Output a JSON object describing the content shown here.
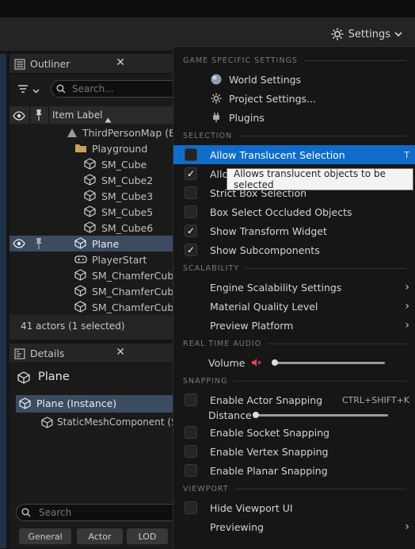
{
  "toolbar": {
    "settings_label": "Settings"
  },
  "outliner": {
    "title": "Outliner",
    "search_placeholder": "Search...",
    "column_item_label": "Item Label",
    "rows": [
      {
        "label": "ThirdPersonMap (Ed",
        "icon": "map-icon"
      },
      {
        "label": "Playground",
        "icon": "folder-icon"
      },
      {
        "label": "SM_Cube",
        "icon": "static-mesh-icon"
      },
      {
        "label": "SM_Cube2",
        "icon": "static-mesh-icon"
      },
      {
        "label": "SM_Cube3",
        "icon": "static-mesh-icon"
      },
      {
        "label": "SM_Cube5",
        "icon": "static-mesh-icon"
      },
      {
        "label": "SM_Cube6",
        "icon": "static-mesh-icon"
      },
      {
        "label": "Plane",
        "icon": "static-mesh-icon"
      },
      {
        "label": "PlayerStart",
        "icon": "player-start-icon"
      },
      {
        "label": "SM_ChamferCube",
        "icon": "static-mesh-icon"
      },
      {
        "label": "SM_ChamferCube",
        "icon": "static-mesh-icon"
      },
      {
        "label": "SM_ChamferCube",
        "icon": "static-mesh-icon"
      }
    ],
    "status": "41 actors (1 selected)"
  },
  "details": {
    "title": "Details",
    "object_name": "Plane",
    "instance_label": "Plane (Instance)",
    "component_label": "StaticMeshComponent (S",
    "search_placeholder": "Search",
    "filter_buttons": [
      "General",
      "Actor",
      "LOD"
    ]
  },
  "menu": {
    "sections": {
      "game_specific": "GAME SPECIFIC SETTINGS",
      "selection": "SELECTION",
      "scalability": "SCALABILITY",
      "real_time_audio": "REAL TIME AUDIO",
      "snapping": "SNAPPING",
      "viewport": "VIEWPORT"
    },
    "game_items": [
      "World Settings",
      "Project Settings...",
      "Plugins"
    ],
    "selection_items": [
      {
        "label": "Allow Translucent Selection",
        "checked": false,
        "shortcut": "T"
      },
      {
        "label": "Allo",
        "checked": true
      },
      {
        "label": "Strict Box Selection",
        "checked": false
      },
      {
        "label": "Box Select Occluded Objects",
        "checked": false
      },
      {
        "label": "Show Transform Widget",
        "checked": true
      },
      {
        "label": "Show Subcomponents",
        "checked": true
      }
    ],
    "scalability_items": [
      "Engine Scalability Settings",
      "Material Quality Level",
      "Preview Platform"
    ],
    "volume_label": "Volume",
    "volume_level": 0.0,
    "snapping_items": [
      {
        "label": "Enable Actor Snapping",
        "shortcut": "CTRL+SHIFT+K"
      },
      {
        "label": "Enable Socket Snapping"
      },
      {
        "label": "Enable Vertex Snapping"
      },
      {
        "label": "Enable Planar Snapping"
      }
    ],
    "distance_label": "Distance",
    "distance_level": 0.0,
    "viewport_items": [
      "Hide Viewport UI",
      "Previewing"
    ],
    "checkmark": "✓",
    "submenu_arrow": "›"
  },
  "tooltip": "Allows translucent objects to be selected",
  "colors": {
    "highlight": "#0f6cc9",
    "selected_row": "#3b4b60",
    "folder": "#c8a060"
  }
}
